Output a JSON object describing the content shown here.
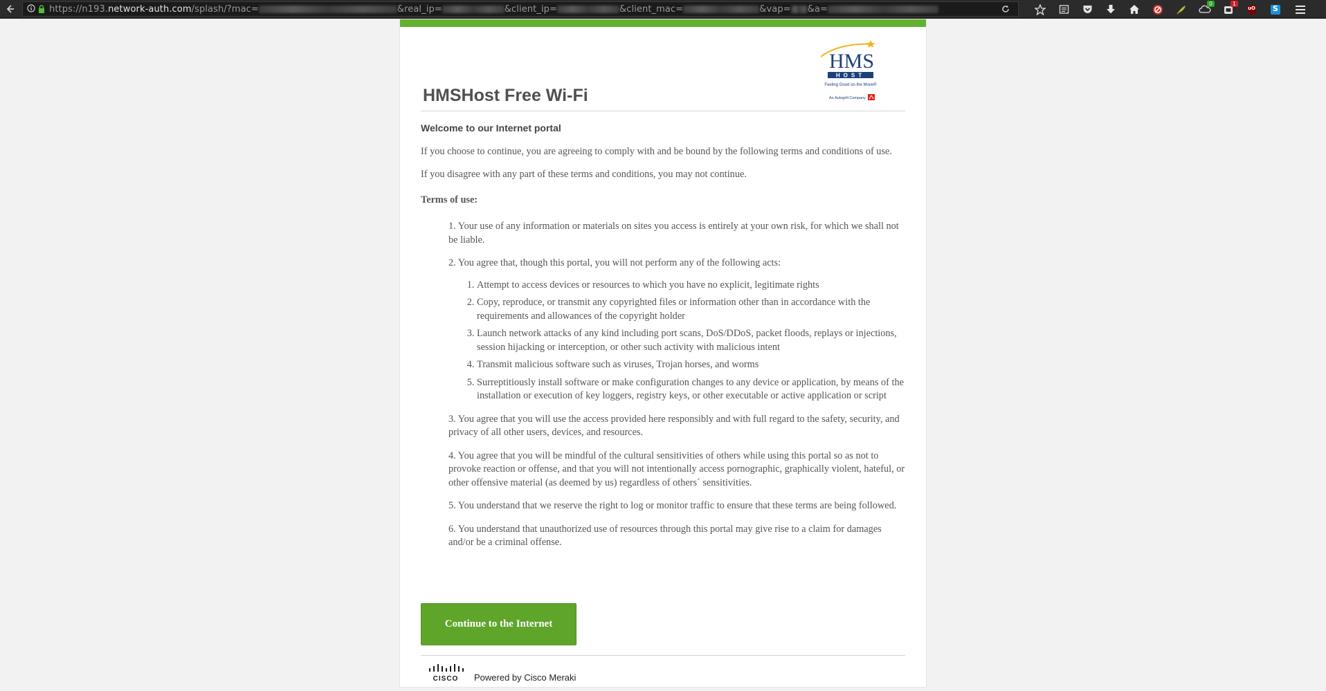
{
  "browser": {
    "url_scheme": "https://",
    "url_subdomain": "n193.",
    "url_host": "network-auth.com",
    "url_path": "/splash/?mac=",
    "url_params": [
      "&real_ip=",
      "&client_ip=",
      "&client_mac=",
      "&vap=",
      "&a="
    ]
  },
  "page": {
    "title": "HMSHost Free Wi-Fi",
    "logo": {
      "name": "HMS",
      "sub": "HOST",
      "tagline": "Feeling Good on the Move®",
      "company": "An Autogrill Company"
    },
    "welcome": "Welcome to our Internet portal",
    "intro1": "If you choose to continue, you are agreeing to comply with and be bound by the following terms and conditions of use.",
    "intro2": "If you disagree with any part of these terms and conditions, you may not continue.",
    "terms_heading": "Terms of use:",
    "terms": [
      "1. Your use of any information or materials on sites you access is entirely at your own risk, for which we shall not be liable.",
      "2. You agree that, though this portal, you will not perform any of the following acts:",
      "3. You agree that you will use the access provided here responsibly and with full regard to the safety, security, and privacy of all other users, devices, and resources.",
      "4. You agree that you will be mindful of the cultural sensitivities of others while using this portal so as not to provoke reaction or offense, and that you will not intentionally access pornographic, graphically violent, hateful, or other offensive material (as deemed by us) regardless of others´ sensitivities.",
      "5. You understand that we reserve the right to log or monitor traffic to ensure that these terms are being followed.",
      "6. You understand that unauthorized use of resources through this portal may give rise to a claim for damages and/or be a criminal offense."
    ],
    "prohibited_acts": [
      "Attempt to access devices or resources to which you have no explicit, legitimate rights",
      "Copy, reproduce, or transmit any copyrighted files or information other than in accordance with the requirements and allowances of the copyright holder",
      "Launch network attacks of any kind including port scans, DoS/DDoS, packet floods, replays or injections, session hijacking or interception, or other such activity with malicious intent",
      "Transmit malicious software such as viruses, Trojan horses, and worms",
      "Surreptitiously install software or make configuration changes to any device or application, by means of the installation or execution of key loggers, registry keys, or other executable or active application or script"
    ],
    "continue_label": "Continue to the Internet",
    "footer": {
      "cisco_label": "CISCO",
      "powered_by": "Powered by Cisco Meraki"
    }
  },
  "extensions": {
    "badge_green": "0",
    "badge_red": "1",
    "ublock_label": "uO",
    "skype_label": "S"
  },
  "colors": {
    "accent_green": "#63b22f",
    "button_green": "#5ea52a",
    "hms_navy": "#1f3f7a",
    "hms_gold": "#f2b51c",
    "autogrill_red": "#e1251b"
  }
}
